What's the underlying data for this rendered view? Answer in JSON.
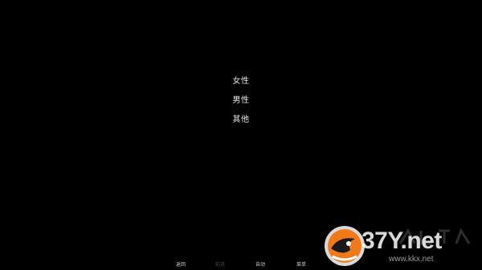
{
  "choices": [
    {
      "label": "女性"
    },
    {
      "label": "男性"
    },
    {
      "label": "其他"
    }
  ],
  "quick_menu": {
    "back": "返回",
    "forward": "前进",
    "auto": "自动",
    "menu": "菜单"
  },
  "watermark": {
    "brand": "37Y.net",
    "url": "www.kkx.net"
  },
  "colors": {
    "background": "#000000",
    "choice_text": "#e6e6e6",
    "menu_text": "#cfcfcf",
    "menu_disabled": "#4a4a4a",
    "logo_orange": "#f07a1a"
  }
}
